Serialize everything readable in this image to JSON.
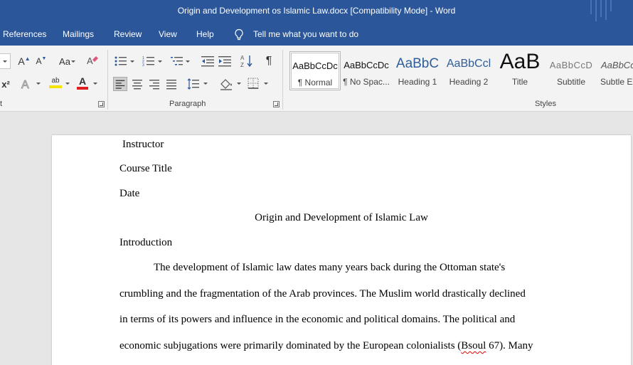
{
  "window": {
    "title": "Origin and Development os Islamic Law.docx [Compatibility Mode]  -  Word"
  },
  "menu": {
    "tabs": [
      "References",
      "Mailings",
      "Review",
      "View",
      "Help"
    ],
    "tell_me": "Tell me what you want to do"
  },
  "ribbon": {
    "groups": {
      "font_partial": "t",
      "paragraph": "Paragraph",
      "styles": "Styles"
    },
    "font": {
      "change_case": "Aa",
      "grow": "A",
      "shrink": "A",
      "superscript": "x²",
      "highlight_text": "ab",
      "font_color_letter": "A"
    },
    "accent_colors": {
      "highlight": "#f5e400",
      "font_color": "#e02020",
      "selected": "#cfcfcf"
    },
    "styles": [
      {
        "preview": "AaBbCcDc",
        "name": "¶ Normal"
      },
      {
        "preview": "AaBbCcDc",
        "name": "¶ No Spac..."
      },
      {
        "preview": "AaBbC",
        "name": "Heading 1"
      },
      {
        "preview": "AaBbCcl",
        "name": "Heading 2"
      },
      {
        "preview": "AaB",
        "name": "Title"
      },
      {
        "preview": "AaBbCcD",
        "name": "Subtitle"
      },
      {
        "preview": "AaBbCcl",
        "name": "Subtle En"
      }
    ]
  },
  "document": {
    "instructor": "Instructor",
    "course_title": "Course Title",
    "date": "Date",
    "heading": "Origin and Development of Islamic Law",
    "intro": "Introduction",
    "para_line1": "The development of Islamic law dates many years back during the Ottoman state's",
    "para_line2": "crumbling and the fragmentation of the Arab provinces. The Muslim world drastically declined",
    "para_line3": "in terms of its powers and influence in the economic and political domains. The political and",
    "para_line4_before": "economic subjugations were primarily dominated by the European colonialists (",
    "para_line4_misspelled": "Bsoul",
    "para_line4_after": " 67). Many"
  }
}
